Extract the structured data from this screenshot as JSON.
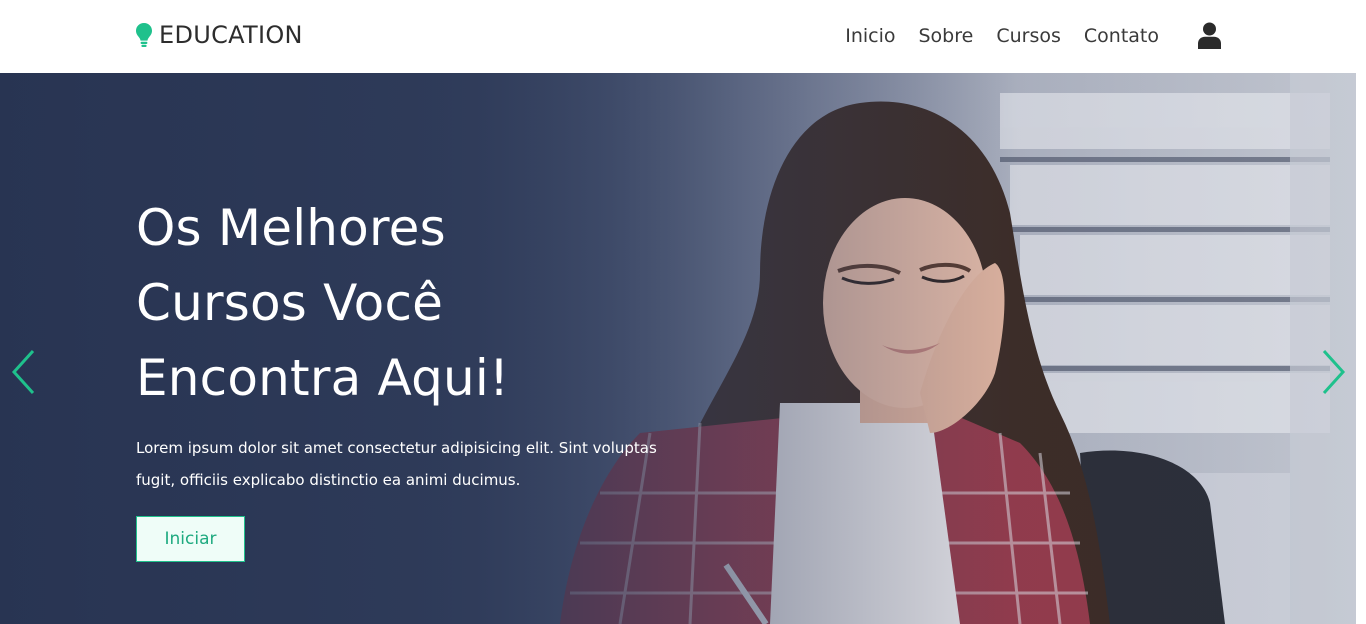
{
  "navbar": {
    "brand": "EDUCATION",
    "brand_icon": "lightbulb-icon",
    "links": [
      "Inicio",
      "Sobre",
      "Cursos",
      "Contato"
    ],
    "user_icon": "user-icon"
  },
  "hero": {
    "title_lines": [
      "Os Melhores",
      "Cursos Você",
      "Encontra Aqui!"
    ],
    "text_lines": [
      "Lorem ipsum dolor sit amet consectetur adipisicing elit. Sint voluptas",
      "fugit, officiis explicabo distinctio ea animi ducimus."
    ],
    "button_label": "Iniciar",
    "prev_icon": "chevron-left-icon",
    "next_icon": "chevron-right-icon"
  },
  "colors": {
    "accent": "#1fc18c",
    "text_dark": "#2d2d2d",
    "hero_overlay": "#2c3a58",
    "button_bg": "#effdf8"
  }
}
